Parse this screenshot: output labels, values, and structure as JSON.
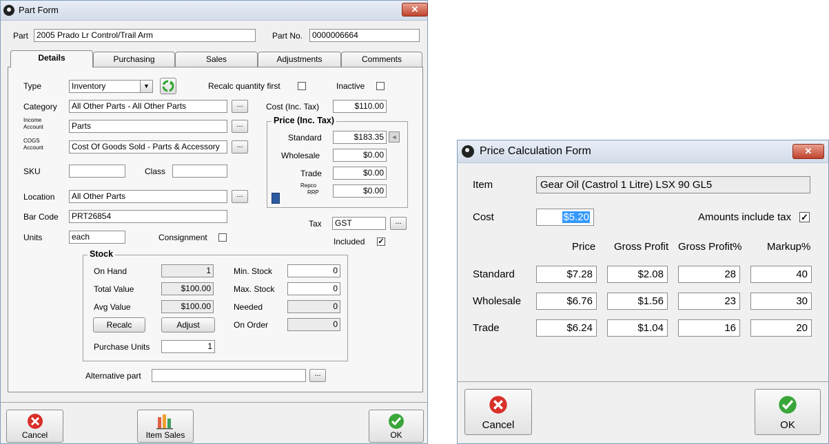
{
  "part_form": {
    "title": "Part Form",
    "close_glyph": "✕",
    "part_label": "Part",
    "part_value": "2005 Prado Lr Control/Trail Arm",
    "part_no_label": "Part No.",
    "part_no_value": "0000006664",
    "tabs": [
      "Details",
      "Purchasing",
      "Sales",
      "Adjustments",
      "Comments"
    ],
    "details": {
      "type_label": "Type",
      "type_value": "Inventory",
      "recalc_label": "Recalc quantity first",
      "inactive_label": "Inactive",
      "category_label": "Category",
      "category_value": "All Other Parts - All Other Parts",
      "cost_label": "Cost (Inc. Tax)",
      "cost_value": "$110.00",
      "income_label_1": "Income",
      "income_label_2": "Account",
      "income_value": "Parts",
      "cogs_label_1": "COGS",
      "cogs_label_2": "Account",
      "cogs_value": "Cost Of Goods Sold - Parts & Accessory",
      "sku_label": "SKU",
      "class_label": "Class",
      "location_label": "Location",
      "location_value": "All Other Parts",
      "barcode_label": "Bar Code",
      "barcode_value": "PRT26854",
      "units_label": "Units",
      "units_value": "each",
      "consignment_label": "Consignment",
      "ellipsis": "...",
      "price_group_title": "Price (Inc. Tax)",
      "standard_label": "Standard",
      "standard_value": "$183.35",
      "wholesale_label": "Wholesale",
      "wholesale_value": "$0.00",
      "trade_label": "Trade",
      "trade_value": "$0.00",
      "repco_label_1": "Repco",
      "repco_label_2": "RRP",
      "repco_value": "$0.00",
      "tax_label": "Tax",
      "tax_value": "GST",
      "included_label": "Included",
      "included_check": "✓",
      "stock_title": "Stock",
      "on_hand_label": "On Hand",
      "on_hand_value": "1",
      "total_value_label": "Total Value",
      "total_value_value": "$100.00",
      "avg_value_label": "Avg Value",
      "avg_value_value": "$100.00",
      "min_stock_label": "Min. Stock",
      "min_stock_value": "0",
      "max_stock_label": "Max. Stock",
      "max_stock_value": "0",
      "needed_label": "Needed",
      "needed_value": "0",
      "on_order_label": "On Order",
      "on_order_value": "0",
      "recalc_button": "Recalc",
      "adjust_button": "Adjust",
      "purchase_units_label": "Purchase Units",
      "purchase_units_value": "1",
      "alternative_label": "Alternative part"
    },
    "buttons": {
      "cancel": "Cancel",
      "item_sales": "Item Sales",
      "ok": "OK"
    }
  },
  "price_calc": {
    "title": "Price Calculation Form",
    "close_glyph": "✕",
    "item_label": "Item",
    "item_value": "Gear Oil (Castrol 1 Litre) LSX 90 GL5",
    "cost_label": "Cost",
    "cost_value": "$5.20",
    "amounts_label": "Amounts include tax",
    "amounts_check": "✓",
    "columns": [
      "Price",
      "Gross Profit",
      "Gross Profit%",
      "Markup%"
    ],
    "rows": [
      {
        "label": "Standard",
        "values": [
          "$7.28",
          "$2.08",
          "28",
          "40"
        ]
      },
      {
        "label": "Wholesale",
        "values": [
          "$6.76",
          "$1.56",
          "23",
          "30"
        ]
      },
      {
        "label": "Trade",
        "values": [
          "$6.24",
          "$1.04",
          "16",
          "20"
        ]
      }
    ],
    "buttons": {
      "cancel": "Cancel",
      "ok": "OK"
    }
  },
  "colors": {
    "cancel": "#d9302a",
    "ok": "#3aa63a",
    "title_bg": "#dbe3ef",
    "selection": "#3399ff"
  }
}
